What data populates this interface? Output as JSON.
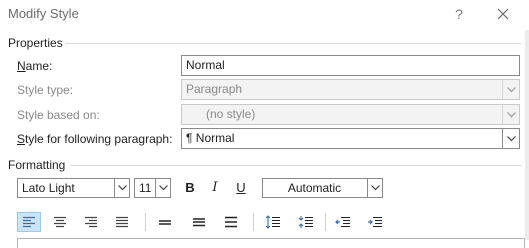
{
  "window": {
    "title": "Modify Style",
    "help_label": "?"
  },
  "properties": {
    "section_label": "Properties",
    "name_label_ul": "N",
    "name_label_rest": "ame:",
    "name_value": "Normal",
    "style_type_label": "Style type:",
    "style_type_value": "Paragraph",
    "based_on_label": "Style based on:",
    "based_on_value": "(no style)",
    "following_label_ul": "S",
    "following_label_rest": "tyle for following paragraph:",
    "following_value": "¶  Normal"
  },
  "formatting": {
    "section_label": "Formatting",
    "font_name": "Lato Light",
    "font_size": "11",
    "bold_label": "B",
    "italic_label": "I",
    "underline_label": "U",
    "color_value": "Automatic"
  },
  "colors": {
    "accent_active_bg": "#cce4f7",
    "accent_active_border": "#99c9ef"
  }
}
